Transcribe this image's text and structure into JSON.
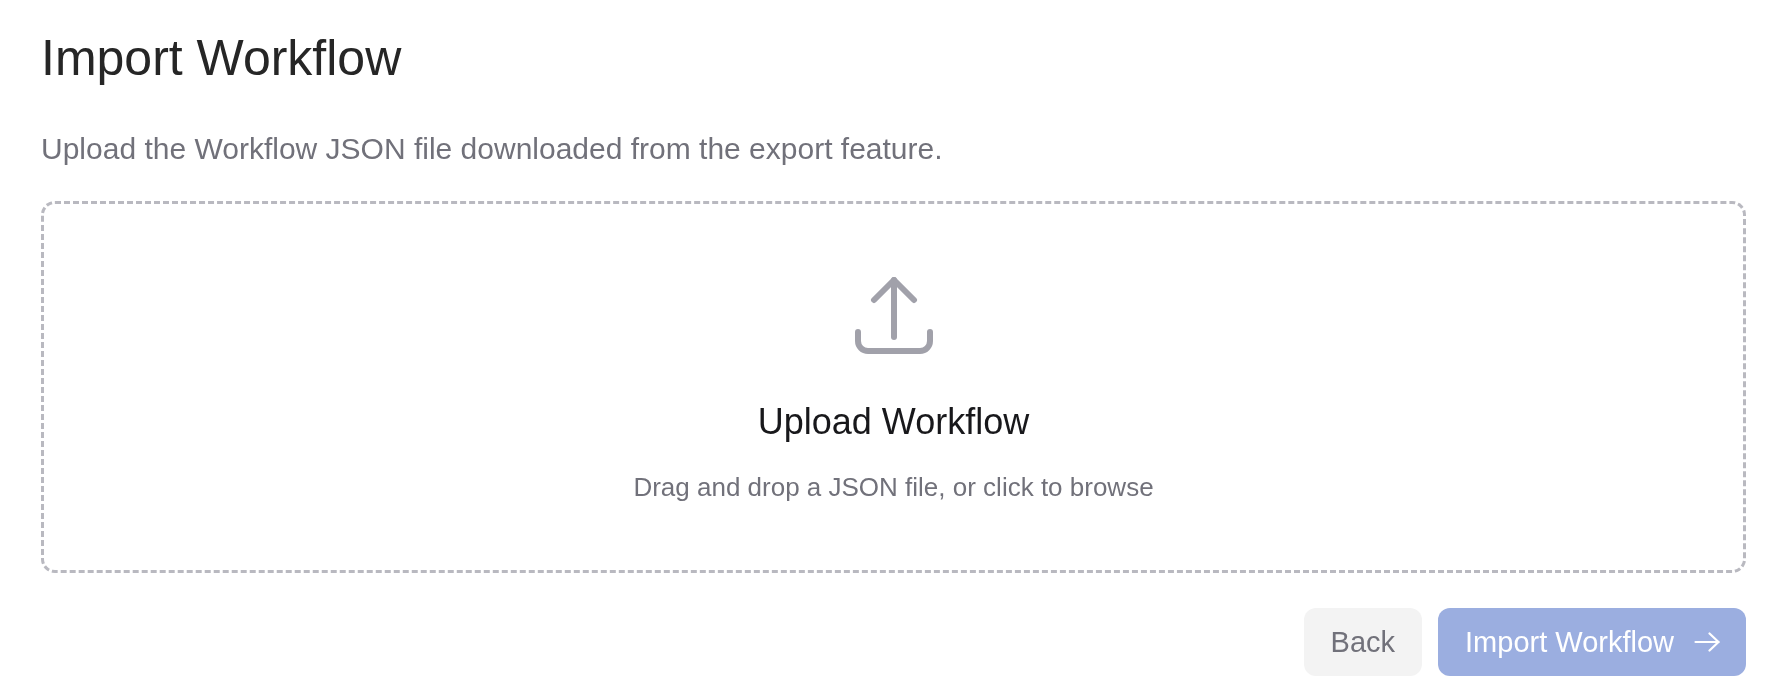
{
  "page": {
    "title": "Import Workflow",
    "description": "Upload the Workflow JSON file downloaded from the export feature."
  },
  "dropzone": {
    "title": "Upload Workflow",
    "hint": "Drag and drop a JSON file, or click to browse"
  },
  "buttons": [
    {
      "label": "Back",
      "kind": "secondary",
      "disabled": false
    },
    {
      "label": "Import Workflow",
      "kind": "primary",
      "disabled": true
    }
  ]
}
